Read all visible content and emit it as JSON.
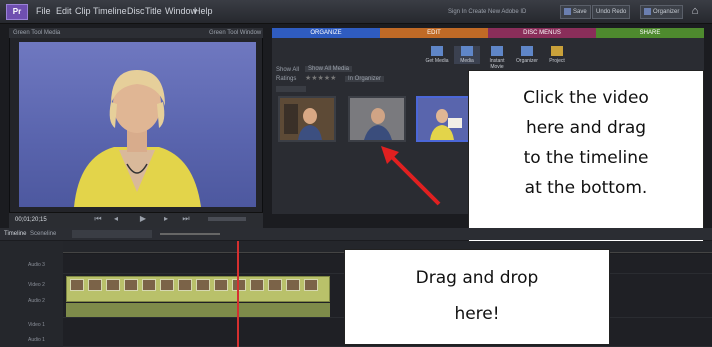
{
  "menubar": {
    "logo": "Pr",
    "items": [
      "File",
      "Edit",
      "Clip",
      "Timeline",
      "Disc",
      "Title",
      "Window",
      "Help"
    ],
    "signin": "Sign In   Create New Adobe ID",
    "buttons": [
      "Save",
      "Undo  Redo",
      "Organizer"
    ]
  },
  "monitor": {
    "header": "Green Tool Media",
    "header_right": "Green Tool Window",
    "timecode": "00;01;20;15"
  },
  "tasks": {
    "tabs": [
      {
        "label": "ORGANIZE",
        "color": "#2f5cc0"
      },
      {
        "label": "EDIT",
        "color": "#c06a26"
      },
      {
        "label": "DISC MENUS",
        "color": "#8a2e5a"
      },
      {
        "label": "SHARE",
        "color": "#4e8a2e"
      }
    ],
    "buttons": [
      "Get Media",
      "Media",
      "Instant Movie",
      "Organizer",
      "Project"
    ],
    "filters": [
      {
        "label": "Show All",
        "value": "Show All Media"
      },
      {
        "label": "Ratings",
        "value": "In Organizer"
      }
    ]
  },
  "timeline": {
    "tabs": [
      "Timeline",
      "Sceneline"
    ],
    "tracks": [
      "Audio 3",
      "Video 2",
      "Audio 2",
      "Video 1",
      "Audio 1"
    ]
  },
  "callouts": {
    "main": [
      "Click the video",
      "here and drag",
      "to the timeline",
      "at the bottom."
    ],
    "drop": [
      "Drag and drop",
      "here!"
    ]
  },
  "colors": {
    "arrow": "#e02020",
    "playhead": "#d43030",
    "selection": "#4b67d8"
  }
}
